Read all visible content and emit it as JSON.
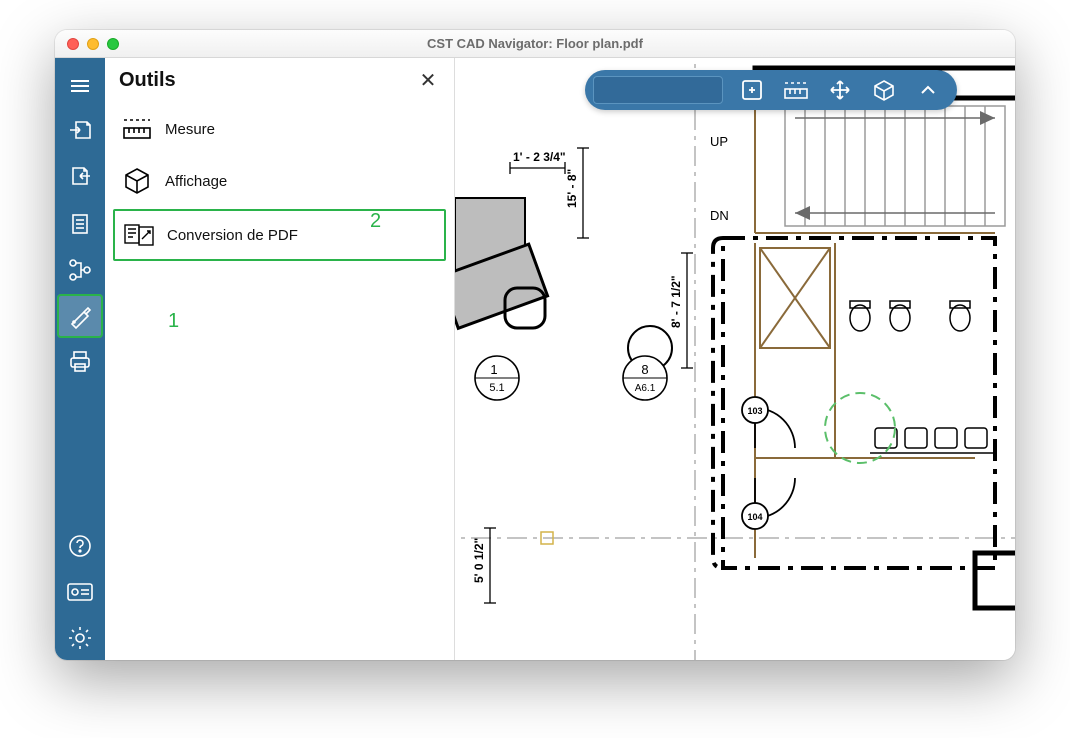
{
  "window": {
    "title": "CST CAD Navigator: Floor plan.pdf"
  },
  "panel": {
    "title": "Outils",
    "close_glyph": "✕",
    "items": [
      {
        "label": "Mesure",
        "icon": "measure-icon"
      },
      {
        "label": "Affichage",
        "icon": "cube-icon"
      },
      {
        "label": "Conversion de PDF",
        "icon": "pdf-convert-icon"
      }
    ]
  },
  "sidebar": {
    "items": [
      {
        "name": "menu-icon"
      },
      {
        "name": "export-icon"
      },
      {
        "name": "import-icon"
      },
      {
        "name": "document-icon"
      },
      {
        "name": "structure-icon"
      },
      {
        "name": "tools-icon",
        "selected": true
      },
      {
        "name": "print-icon"
      }
    ],
    "bottom_items": [
      {
        "name": "help-icon"
      },
      {
        "name": "license-icon"
      },
      {
        "name": "settings-icon"
      }
    ]
  },
  "toolbar": {
    "buttons": [
      {
        "name": "fit-view-icon"
      },
      {
        "name": "measure-tool-icon"
      },
      {
        "name": "pan-icon"
      },
      {
        "name": "cube-view-icon"
      },
      {
        "name": "collapse-icon"
      }
    ]
  },
  "annotations": {
    "callout1": "1",
    "callout2": "2"
  },
  "drawing": {
    "labels": {
      "up": "UP",
      "dn": "DN",
      "dim1": "1' - 2 3/4\"",
      "dim_v1": "15' - 8\"",
      "dim_v2": "8' - 7 1/2\"",
      "dim_v3": "5' 0 1/2\"",
      "bubble1_top": "1",
      "bubble1_bot": "5.1",
      "bubble2_top": "8",
      "bubble2_bot": "A6.1",
      "room1": "103",
      "room2": "104"
    }
  }
}
